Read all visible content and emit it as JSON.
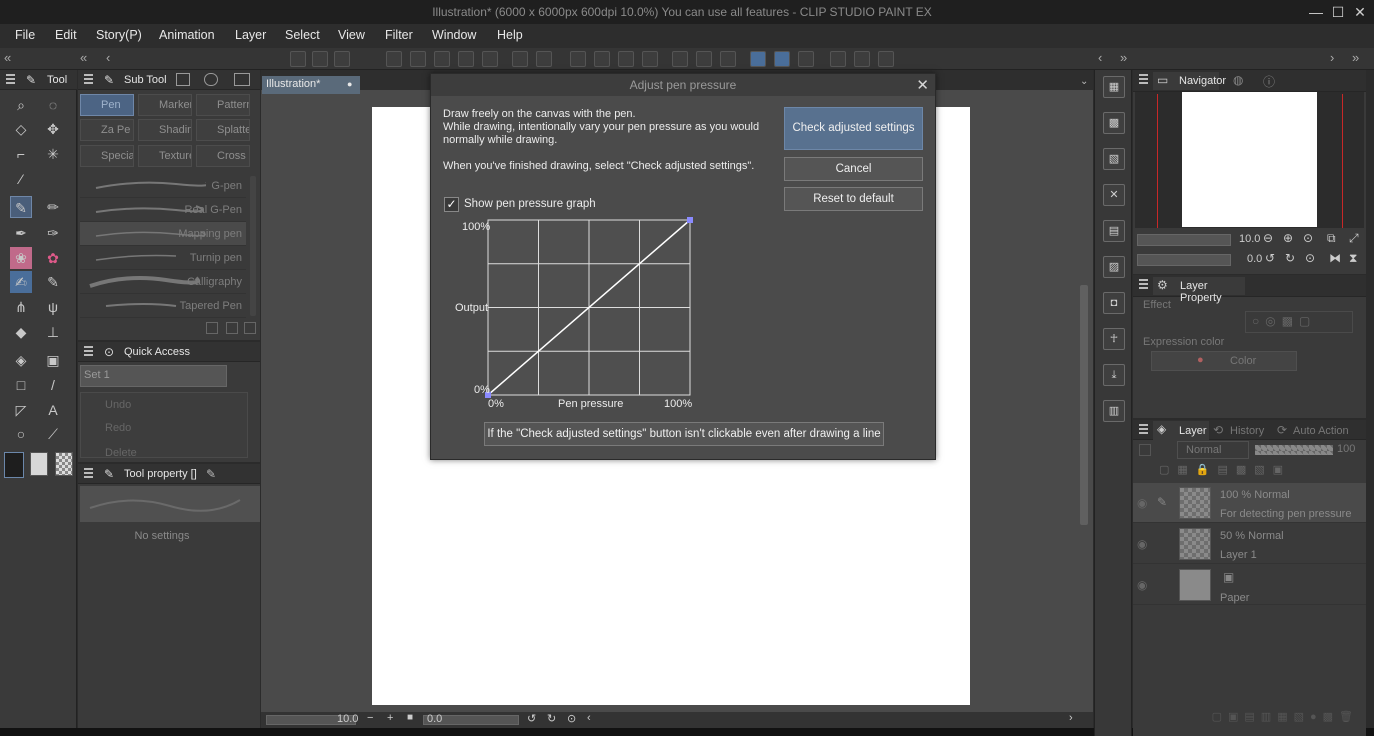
{
  "window": {
    "title": "Illustration* (6000 x 6000px 600dpi 10.0%)  You can use all features - CLIP STUDIO PAINT EX",
    "min": "—",
    "max": "☐",
    "close": "✕"
  },
  "menu": [
    "File",
    "Edit",
    "Story(P)",
    "Animation",
    "Layer",
    "Select",
    "View",
    "Filter",
    "Window",
    "Help"
  ],
  "tool_panel": {
    "title": "Tool"
  },
  "subtool_panel": {
    "title": "Sub Tool",
    "groups": [
      "Pen",
      "Marker",
      "Pattern",
      "Za Pe",
      "Shading",
      "Splatter",
      "Special",
      "Texture",
      "Cross"
    ],
    "brushes": [
      "G-pen",
      "Real G-Pen",
      "Mapping pen",
      "Turnip pen",
      "Calligraphy",
      "Tapered Pen"
    ]
  },
  "quick_access": {
    "title": "Quick Access",
    "set": "Set 1",
    "items": [
      "Undo",
      "Redo",
      "Delete"
    ]
  },
  "tool_property": {
    "title": "Tool property []",
    "empty": "No settings"
  },
  "document_tab": {
    "name": "Illustration*"
  },
  "dialog": {
    "title": "Adjust pen pressure",
    "close": "✕",
    "line1": "Draw freely on the canvas with the pen.",
    "line2": "While drawing, intentionally vary your pen pressure as you would",
    "line3": "normally while drawing.",
    "line4": "When you've finished drawing, select \"Check adjusted settings\".",
    "btn_check": "Check adjusted settings",
    "btn_cancel": "Cancel",
    "btn_reset": "Reset to default",
    "checkbox_label": "Show pen pressure graph",
    "checkbox_checked": true,
    "graph_y_top": "100%",
    "graph_y_mid": "Output",
    "graph_y_bottom": "0%",
    "graph_x_left": "0%",
    "graph_x_mid": "Pen pressure",
    "graph_x_right": "100%",
    "btn_help": "If the \"Check adjusted settings\" button isn't clickable even after drawing a line"
  },
  "status_bar": {
    "zoom": "10.0",
    "angle": "0.0"
  },
  "navigator": {
    "title": "Navigator",
    "zoom": "10.0",
    "angle": "0.0"
  },
  "layer_property": {
    "title": "Layer Property",
    "effect": "Effect",
    "expression_color": "Expression color",
    "color": "Color"
  },
  "layer_panel": {
    "tabs": [
      "Layer",
      "History",
      "Auto Action"
    ],
    "blend": "Normal",
    "opacity": "100",
    "layers": [
      {
        "l1": "100 % Normal",
        "l2": "For detecting pen pressure"
      },
      {
        "l1": "50 % Normal",
        "l2": "Layer 1"
      },
      {
        "l1": "",
        "l2": "Paper"
      }
    ]
  }
}
